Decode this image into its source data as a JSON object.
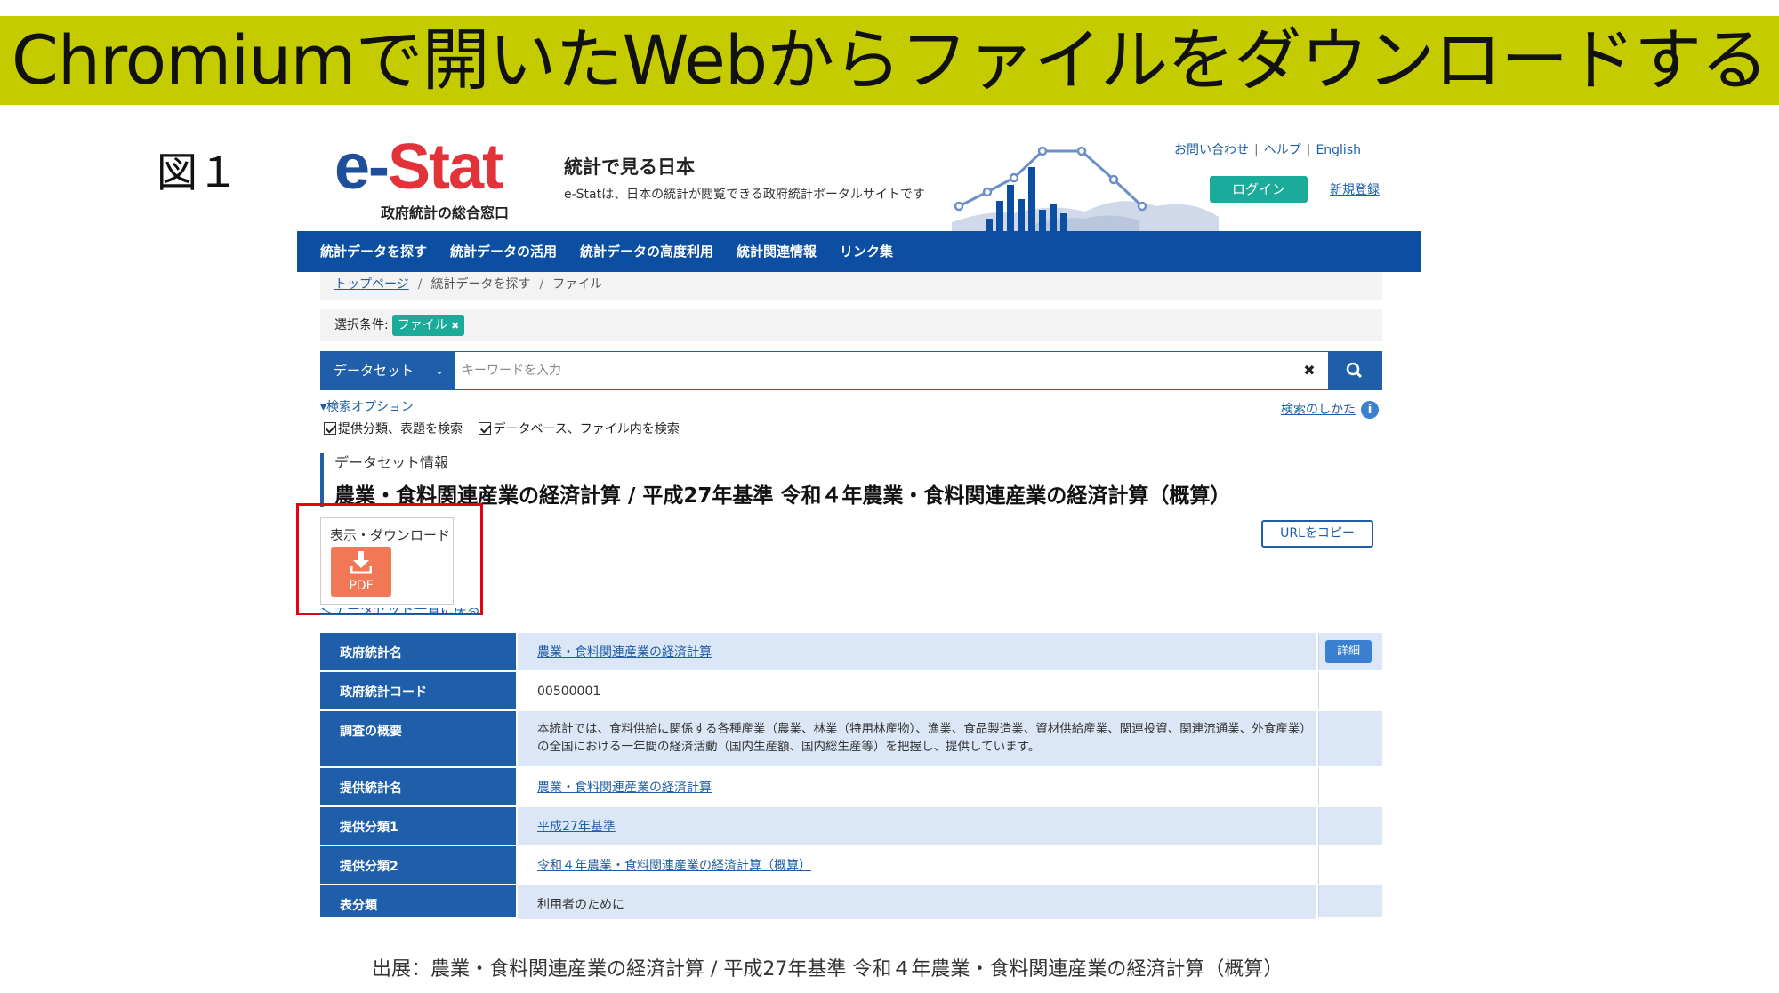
{
  "slide": {
    "title": "Chromiumで開いたWebからファイルをダウンロードする",
    "figure_label": "図１",
    "source_note": "出展：農業・食料関連産業の経済計算 / 平成27年基準 令和４年農業・食料関連産業の経済計算（概算）",
    "banner_color": "#c4cc00",
    "highlight_color": "#e60012"
  },
  "site": {
    "logo_e": "e-",
    "logo_stat": "Stat",
    "logo_sub": "政府統計の総合窓口",
    "title": "統計で見る日本",
    "description": "e-Statは、日本の統計が閲覧できる政府統計ポータルサイトです",
    "top_links": [
      "お問い合わせ",
      "ヘルプ",
      "English"
    ],
    "login_label": "ログイン",
    "register_label": "新規登録",
    "brand_blue": "#0b4ea2",
    "accent_teal": "#1aab9b"
  },
  "nav": {
    "items": [
      "統計データを探す",
      "統計データの活用",
      "統計データの高度利用",
      "統計関連情報",
      "リンク集"
    ]
  },
  "breadcrumb": {
    "items": [
      "トップページ",
      "統計データを探す",
      "ファイル"
    ]
  },
  "condition": {
    "label": "選択条件:",
    "tag": "ファイル",
    "tag_remove_icon": "✖"
  },
  "search": {
    "select_value": "データセット",
    "placeholder": "キーワードを入力",
    "clear_icon": "✖",
    "options_link": "▾検索オプション",
    "howto_link": "検索のしかた",
    "info_icon": "i",
    "checks": [
      "提供分類、表題を検索",
      "データベース、ファイル内を検索"
    ]
  },
  "dataset": {
    "label": "データセット情報",
    "title": "農業・食料関連産業の経済計算 / 平成27年基準 令和４年農業・食料関連産業の経済計算（概算）",
    "download_label": "表示・ダウンロード",
    "pdf_label": "PDF",
    "url_copy_label": "URLをコピー",
    "back_link": "＜データセット一覧に戻る"
  },
  "table": {
    "rows": [
      {
        "header": "政府統計名",
        "value": "農業・食料関連産業の経済計算",
        "link": true,
        "detail": "詳細"
      },
      {
        "header": "政府統計コード",
        "value": "00500001",
        "link": false
      },
      {
        "header": "調査の概要",
        "value": "本統計では、食料供給に関係する各種産業（農業、林業（特用林産物）、漁業、食品製造業、資材供給産業、関連投資、関連流通業、外食産業）の全国における一年間の経済活動（国内生産額、国内総生産等）を把握し、提供しています。",
        "link": false
      },
      {
        "header": "提供統計名",
        "value": "農業・食料関連産業の経済計算",
        "link": true
      },
      {
        "header": "提供分類1",
        "value": "平成27年基準",
        "link": true
      },
      {
        "header": "提供分類2",
        "value": "令和４年農業・食料関連産業の経済計算（概算）",
        "link": true
      },
      {
        "header": "表分類",
        "value": "利用者のために",
        "link": false
      }
    ]
  }
}
